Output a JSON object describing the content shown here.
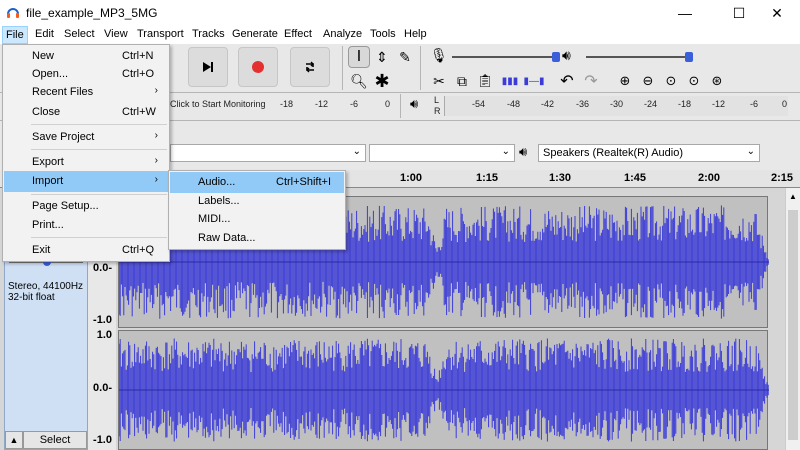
{
  "window": {
    "title": "file_example_MP3_5MG",
    "minimize": "—",
    "maximize": "☐",
    "close": "✕"
  },
  "menubar": [
    "File",
    "Edit",
    "Select",
    "View",
    "Transport",
    "Tracks",
    "Generate",
    "Effect",
    "Analyze",
    "Tools",
    "Help"
  ],
  "file_menu": {
    "new": {
      "label": "New",
      "shortcut": "Ctrl+N"
    },
    "open": {
      "label": "Open...",
      "shortcut": "Ctrl+O"
    },
    "recent": {
      "label": "Recent Files"
    },
    "close": {
      "label": "Close",
      "shortcut": "Ctrl+W"
    },
    "save_project": {
      "label": "Save Project"
    },
    "export": {
      "label": "Export"
    },
    "import": {
      "label": "Import"
    },
    "page_setup": {
      "label": "Page Setup..."
    },
    "print": {
      "label": "Print..."
    },
    "exit": {
      "label": "Exit",
      "shortcut": "Ctrl+Q"
    }
  },
  "import_menu": {
    "audio": {
      "label": "Audio...",
      "shortcut": "Ctrl+Shift+I"
    },
    "labels": {
      "label": "Labels..."
    },
    "midi": {
      "label": "MIDI..."
    },
    "raw": {
      "label": "Raw Data..."
    }
  },
  "meters": {
    "monitor_text": "Click to Start Monitoring",
    "rec_ticks": [
      "-18",
      "-12",
      "-6",
      "0"
    ],
    "play_ticks": [
      "-54",
      "-48",
      "-42",
      "-36",
      "-30",
      "-24",
      "-18",
      "-12",
      "-6",
      "0"
    ],
    "lr": {
      "l": "L",
      "r": "R"
    }
  },
  "devices": {
    "playback": "Speakers (Realtek(R) Audio)"
  },
  "ruler": {
    "ticks": [
      "1:00",
      "1:15",
      "1:30",
      "1:45",
      "2:00",
      "2:15"
    ]
  },
  "track": {
    "info_rate": "Stereo, 44100Hz",
    "info_format": "32-bit float",
    "select_label": "Select",
    "scale_top": [
      "0.0-",
      "-1.0"
    ],
    "scale_bottom": [
      "1.0",
      "0.0-",
      "-1.0"
    ]
  },
  "colors": {
    "waveform": "#3b3bd8",
    "record": "#e53030",
    "highlight": "#91c9f7"
  }
}
